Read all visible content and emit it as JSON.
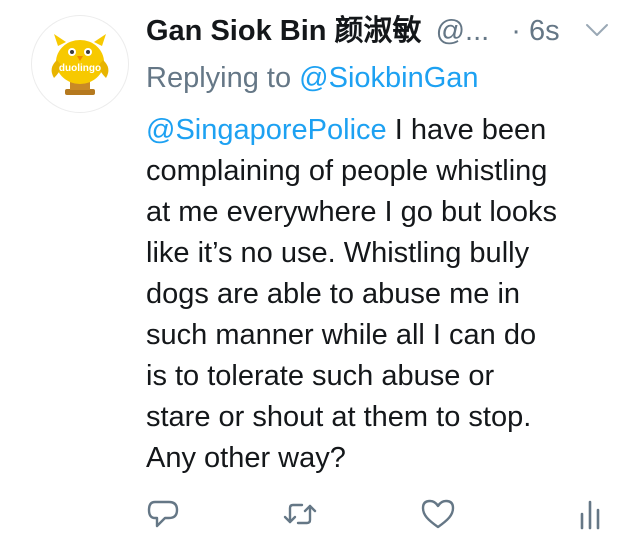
{
  "tweet": {
    "display_name": "Gan Siok Bin 颜淑敏",
    "handle": "@...",
    "separator": "·",
    "time": "6s",
    "replying_prefix": "Replying to",
    "replying_to": "@SiokbinGan",
    "mention": "@SingaporePolice",
    "body_lines": [
      "I have been",
      "complaining of people whistling",
      "at me everywhere I go but looks",
      "like it’s no use. Whistling bully",
      "dogs are able to abuse me in",
      "such manner while all I can do",
      "is to tolerate such abuse or",
      "stare or shout at them to stop.",
      "Any other way?"
    ],
    "avatar_text": "duolingo"
  },
  "actions": [
    {
      "icon": "reply-icon"
    },
    {
      "icon": "retweet-icon"
    },
    {
      "icon": "like-icon"
    },
    {
      "icon": "analytics-icon"
    }
  ],
  "colors": {
    "link": "#1da1f2",
    "muted": "#657786",
    "text": "#14171a",
    "owl": "#f7c900",
    "trophy": "#b5791f"
  }
}
